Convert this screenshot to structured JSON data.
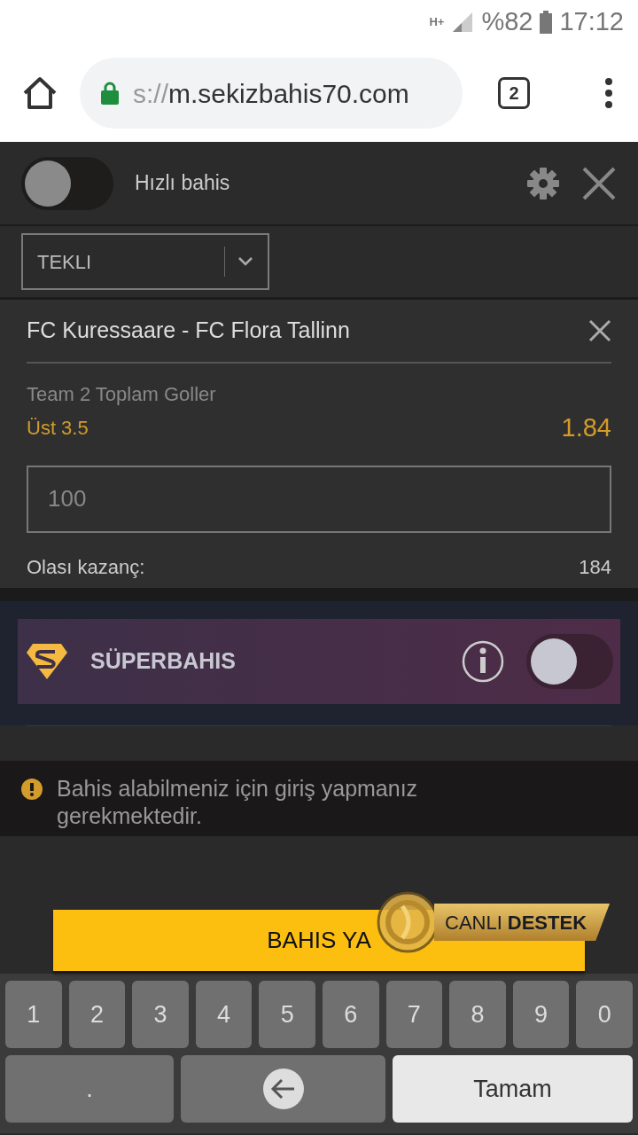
{
  "status_bar": {
    "network": "H+",
    "battery": "%82",
    "time": "17:12"
  },
  "browser": {
    "url_prefix": "s://",
    "url": "m.sekizbahis70.com",
    "tab_count": "2"
  },
  "betslip": {
    "quick_bet": {
      "label": "Hızlı bahis",
      "on": false
    },
    "bet_type": "TEKLI",
    "bet": {
      "match": "FC Kuressaare - FC Flora Tallinn",
      "market": "Team 2 Toplam Goller",
      "selection": "Üst 3.5",
      "odds": "1.84",
      "stake": "100",
      "win_label": "Olası kazanç:",
      "win_value": "184"
    },
    "superbahis": {
      "label": "SÜPERBAHIS",
      "on": false
    },
    "warning": "Bahis alabilmeniz için giriş yapmanız gerekmektedir.",
    "submit": "BAHIS YA",
    "support": {
      "label_1": "CANLI",
      "label_2": "DESTEK"
    }
  },
  "keyboard": {
    "digit_keys": [
      {
        "kind": "key",
        "label": "1"
      },
      {
        "kind": "key",
        "label": "2"
      },
      {
        "kind": "key",
        "label": "3"
      },
      {
        "kind": "key",
        "label": "4"
      },
      {
        "kind": "key",
        "label": "5"
      },
      {
        "kind": "key",
        "label": "6"
      },
      {
        "kind": "key",
        "label": "7"
      },
      {
        "kind": "key",
        "label": "8"
      },
      {
        "kind": "key",
        "label": "9"
      },
      {
        "kind": "key",
        "label": "0"
      }
    ],
    "action_keys": [
      {
        "kind": "key",
        "label": "."
      },
      {
        "kind": "backspace"
      },
      {
        "kind": "done",
        "label": "Tamam"
      }
    ]
  }
}
